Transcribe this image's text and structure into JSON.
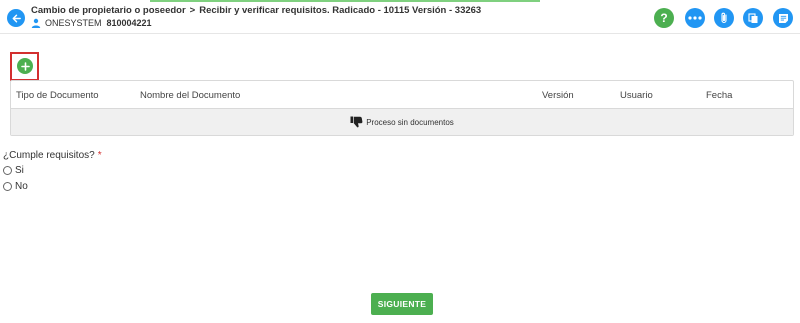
{
  "header": {
    "process_name": "Cambio de propietario o poseedor",
    "separator": ">",
    "step_title": "Recibir y verificar requisitos. Radicado - 10115 Versión - 33263",
    "user_name": "ONESYSTEM",
    "user_id": "810004221",
    "help_glyph": "?",
    "icons": [
      "back-arrow-icon",
      "help-icon",
      "more-options-icon",
      "paperclip-icon",
      "copy-icon",
      "notes-icon"
    ]
  },
  "documents": {
    "add_icon": "plus-icon",
    "columns": [
      "Tipo de Documento",
      "Nombre del Documento",
      "Versión",
      "Usuario",
      "Fecha"
    ],
    "empty_icon": "thumbs-down-icon",
    "empty_text": "Proceso sin documentos"
  },
  "form": {
    "question": "¿Cumple requisitos?",
    "required_mark": "*",
    "options": [
      "Si",
      "No"
    ],
    "selected": null
  },
  "footer": {
    "next_label": "SIGUIENTE"
  },
  "colors": {
    "primary_blue": "#2196f3",
    "success_green": "#4caf50",
    "highlight_red": "#d32f2f",
    "empty_row_bg": "#f0f0f0"
  }
}
